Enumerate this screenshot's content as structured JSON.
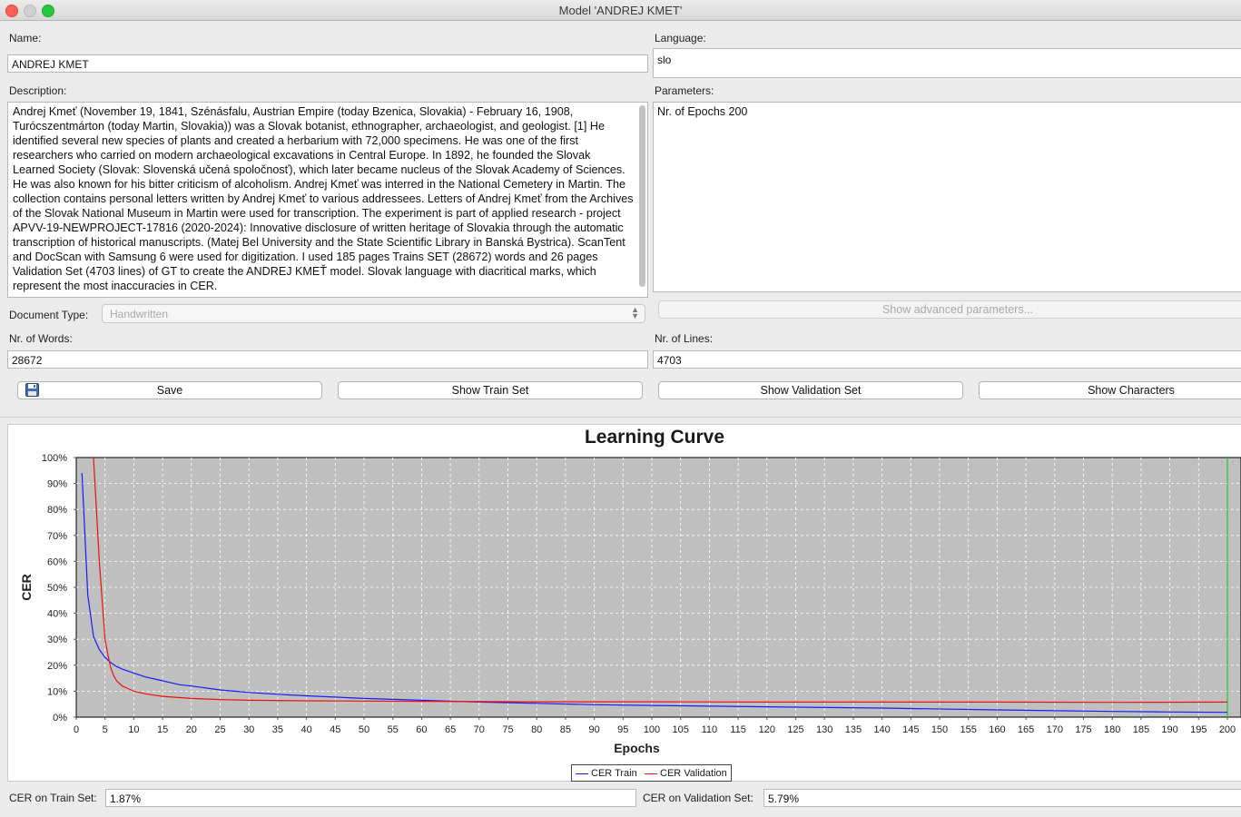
{
  "window": {
    "title": "Model 'ANDREJ KMET'"
  },
  "form": {
    "name_label": "Name:",
    "name_value": "ANDREJ KMET",
    "language_label": "Language:",
    "language_value": "slo",
    "description_label": "Description:",
    "description_value": "Andrej Kmeť (November 19, 1841, Szénásfalu, Austrian Empire (today Bzenica, Slovakia) - February 16, 1908, Turócszentmárton (today Martin, Slovakia)) was a Slovak botanist, ethnographer, archaeologist, and geologist. [1] He identified several new species of plants and created a herbarium with 72,000 specimens. He was one of the first researchers who carried on modern archaeological excavations in Central Europe. In 1892, he founded the Slovak Learned Society (Slovak: Slovenská učená spoločnosť), which later became nucleus of the Slovak Academy of Sciences. He was also known for his bitter criticism of alcoholism. Andrej Kmeť was interred in the National Cemetery in Martin. The collection contains personal letters written by Andrej Kmeť to various addressees. Letters of Andrej Kmeť from the Archives of the Slovak National Museum in Martin were used for transcription. The experiment is part of applied research - project APVV-19-NEWPROJECT-17816 (2020-2024): Innovative disclosure of written heritage of Slovakia through the automatic transcription of historical manuscripts. (Matej Bel University and the State Scientific Library in Banská Bystrica). ScanTent and DocScan with Samsung 6 were used for digitization. I used 185 pages Trains SET (28672) words and 26 pages Validation Set (4703 lines) of GT to create the ANDREJ KMEŤ model. Slovak language with diacritical marks, which represent the most inaccuracies in CER.",
    "parameters_label": "Parameters:",
    "parameters_value": "Nr. of Epochs  200",
    "doctype_label": "Document Type:",
    "doctype_value": "Handwritten",
    "advanced_label": "Show advanced parameters...",
    "words_label": "Nr. of Words:",
    "words_value": "28672",
    "lines_label": "Nr. of Lines:",
    "lines_value": "4703"
  },
  "buttons": {
    "save": "Save",
    "train_set": "Show Train Set",
    "validation_set": "Show Validation Set",
    "characters": "Show Characters"
  },
  "footer": {
    "train_cer_label": "CER on Train Set:",
    "train_cer_value": "1.87%",
    "val_cer_label": "CER on Validation Set:",
    "val_cer_value": "5.79%"
  },
  "colors": {
    "train": "#1a1aff",
    "validation": "#ee1111",
    "plot_bg": "#c0c0c0",
    "marker": "#22cc22"
  },
  "chart_data": {
    "type": "line",
    "title": "Learning Curve",
    "xlabel": "Epochs",
    "ylabel": "CER",
    "xlim": [
      0,
      200
    ],
    "ylim": [
      0,
      100
    ],
    "x_ticks": [
      0,
      5,
      10,
      15,
      20,
      25,
      30,
      35,
      40,
      45,
      50,
      55,
      60,
      65,
      70,
      75,
      80,
      85,
      90,
      95,
      100,
      105,
      110,
      115,
      120,
      125,
      130,
      135,
      140,
      145,
      150,
      155,
      160,
      165,
      170,
      175,
      180,
      185,
      190,
      195,
      200
    ],
    "y_ticks": [
      "0%",
      "10%",
      "20%",
      "30%",
      "40%",
      "50%",
      "60%",
      "70%",
      "80%",
      "90%",
      "100%"
    ],
    "grid": true,
    "legend_position": "bottom-center",
    "vertical_marker_x": 200,
    "series": [
      {
        "name": "CER Train",
        "x": [
          1,
          2,
          3,
          4,
          5,
          6,
          7,
          8,
          10,
          12,
          14,
          16,
          18,
          20,
          25,
          30,
          35,
          40,
          50,
          60,
          70,
          80,
          90,
          100,
          120,
          140,
          160,
          180,
          190,
          200
        ],
        "y": [
          94,
          47,
          31,
          26,
          23,
          21,
          19.5,
          18.5,
          17,
          15.5,
          14.5,
          13.5,
          12.5,
          12,
          10.5,
          9.5,
          8.8,
          8.2,
          7.2,
          6.5,
          5.8,
          5.3,
          4.8,
          4.5,
          4,
          3.5,
          2.8,
          2.2,
          2,
          1.87
        ]
      },
      {
        "name": "CER Validation",
        "x": [
          3,
          3.5,
          4,
          4.5,
          5,
          5.5,
          6,
          6.5,
          7,
          8,
          9,
          10,
          12,
          15,
          20,
          25,
          30,
          40,
          50,
          60,
          80,
          100,
          120,
          140,
          160,
          180,
          200
        ],
        "y": [
          100,
          80,
          60,
          45,
          30,
          24,
          19,
          16,
          14,
          12,
          11,
          10,
          9,
          8,
          7.2,
          6.8,
          6.5,
          6.3,
          6.2,
          6.1,
          5.9,
          5.9,
          5.8,
          5.8,
          5.8,
          5.7,
          5.79
        ]
      }
    ]
  }
}
